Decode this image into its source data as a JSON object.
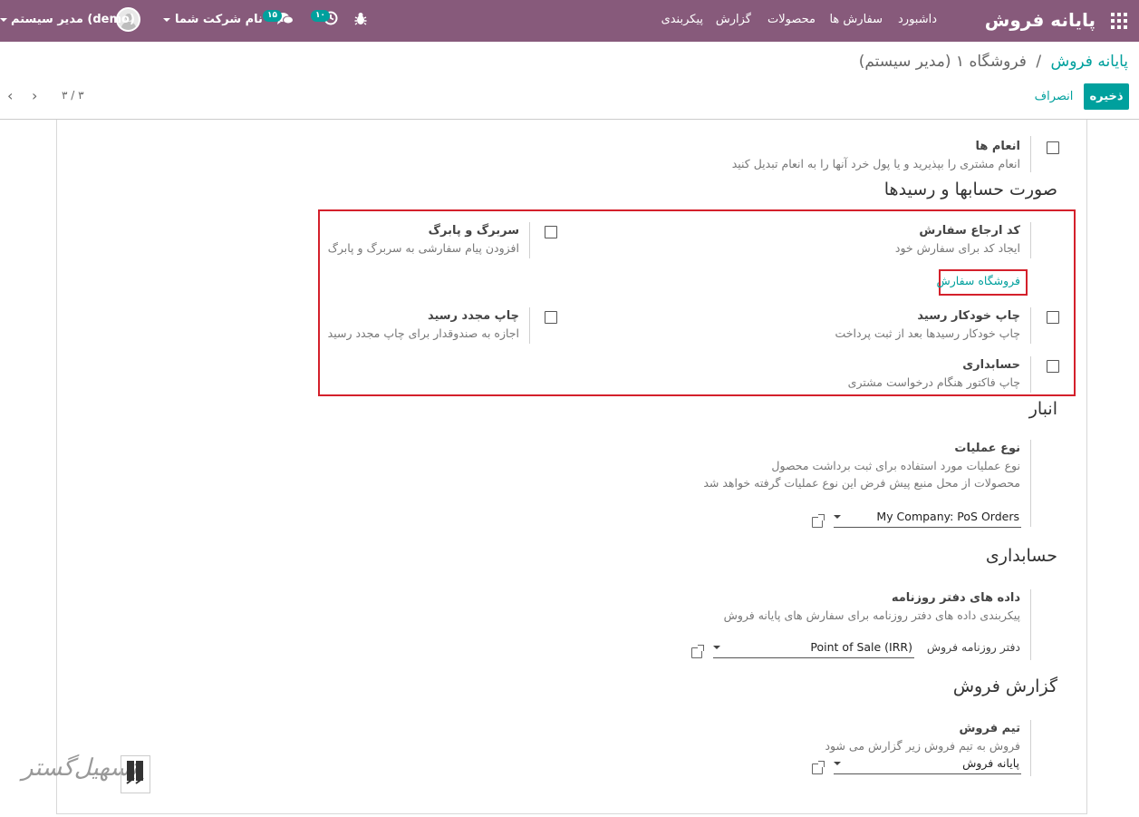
{
  "navbar": {
    "app_title": "پایانه فروش",
    "menu": [
      "داشبورد",
      "سفارش ها",
      "محصولات",
      "گزارش",
      "پیکربندی"
    ],
    "user": "مدیر سیستم (demo)",
    "company": "نام شرکت شما",
    "messages_count": "۱۵",
    "activities_count": "۱۰"
  },
  "breadcrumb": {
    "root": "پایانه فروش",
    "separator": "/",
    "current": "فروشگاه ۱ (مدیر سیستم)"
  },
  "actions": {
    "save": "ذخیره",
    "discard": "انصراف"
  },
  "pager": {
    "text": "۳ / ۳"
  },
  "tips": {
    "label": "انعام ها",
    "desc": "انعام مشتری را بپذیرید و یا پول خرد آنها را به انعام تبدیل کنید"
  },
  "bills_section": {
    "title": "صورت حسابها و رسیدها",
    "order_reference": {
      "label": "کد ارجاع سفارش",
      "desc": "ایجاد کد برای سفارش خود",
      "link": "فروشگاه سفارش"
    },
    "header_footer": {
      "label": "سربرگ و پابرگ",
      "desc": "افزودن پیام سفارشی به سربرگ و پابرگ"
    },
    "auto_print": {
      "label": "چاپ خودکار رسید",
      "desc": "چاپ خودکار رسیدها بعد از ثبت پرداخت"
    },
    "reprint": {
      "label": "چاپ مجدد رسید",
      "desc": "اجازه به صندوقدار برای چاپ مجدد رسید"
    },
    "invoicing": {
      "label": "حسابداری",
      "desc": "چاپ فاکتور هنگام درخواست مشتری"
    }
  },
  "inventory_section": {
    "title": "انبار",
    "label": "نوع عملیات",
    "desc1": "نوع عملیات مورد استفاده برای ثبت برداشت محصول",
    "desc2": "محصولات از محل منبع پیش فرض این نوع عملیات گرفته خواهد شد",
    "value": "My Company: PoS Orders"
  },
  "accounting_section": {
    "title": "حسابداری",
    "label": "داده های دفتر روزنامه",
    "desc": "پیکربندی داده های دفتر روزنامه برای سفارش های پایانه فروش",
    "field_label": "دفتر روزنامه فروش",
    "value": "Point of Sale (IRR)"
  },
  "sales_report_section": {
    "title": "گزارش فروش",
    "label": "تیم فروش",
    "desc": "فروش به تیم فروش زیر گزارش می شود",
    "value": "پایانه فروش"
  },
  "watermark": "تسهیل‌گستر"
}
